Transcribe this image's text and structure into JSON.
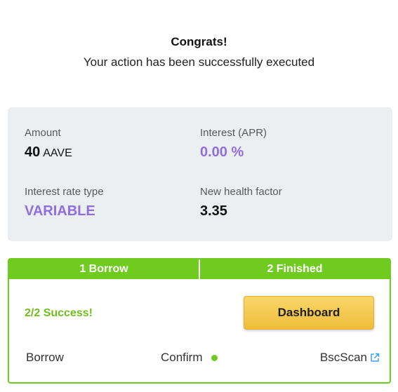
{
  "header": {
    "title": "Congrats!",
    "subtitle": "Your action has been successfully executed"
  },
  "summary": {
    "amount": {
      "label": "Amount",
      "value": "40",
      "unit": "AAVE"
    },
    "interest": {
      "label": "Interest (APR)",
      "value": "0.00 %"
    },
    "rate_type": {
      "label": "Interest rate type",
      "value": "VARIABLE"
    },
    "health_factor": {
      "label": "New health factor",
      "value": "3.35"
    }
  },
  "steps": {
    "tabs": [
      {
        "label": "1 Borrow"
      },
      {
        "label": "2 Finished"
      }
    ],
    "success_text": "2/2 Success!",
    "dashboard_label": "Dashboard",
    "row": {
      "action": "Borrow",
      "status": "Confirm",
      "explorer_link": "BscScan"
    }
  },
  "colors": {
    "accent_green": "#6fcb1f",
    "accent_purple": "#8f6ee0",
    "button_yellow": "#f4c74e",
    "panel_gray": "#eceff1"
  },
  "icons": {
    "status": "status-dot-icon",
    "external": "external-link-icon"
  }
}
